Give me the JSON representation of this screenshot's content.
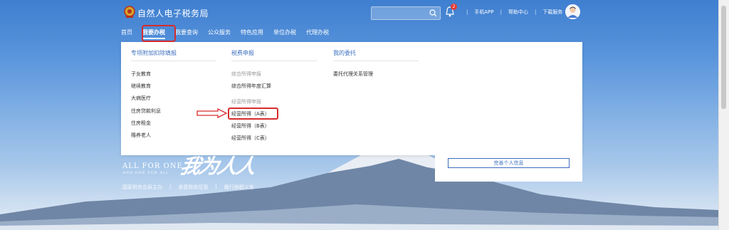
{
  "header": {
    "site_title": "自然人电子税务局",
    "search_placeholder": "",
    "notification_count": "2",
    "links": [
      "手机APP",
      "帮助中心",
      "下载服务"
    ]
  },
  "nav": {
    "items": [
      "首页",
      "我要办税",
      "我要查询",
      "公众服务",
      "特色应用",
      "单位办税",
      "代理办税"
    ],
    "active_index": 1
  },
  "dropdown": {
    "columns": [
      {
        "heading": "专项附加扣除填报",
        "items": [
          "子女教育",
          "继续教育",
          "大病医疗",
          "住房贷款利息",
          "住房租金",
          "赡养老人"
        ]
      },
      {
        "heading": "税费申报",
        "items": [
          {
            "label": "综合所得申报",
            "muted": true
          },
          {
            "label": "综合所得年度汇算",
            "muted": false
          },
          {
            "label": "经营所得申报",
            "muted": true
          },
          {
            "label": "经营所得（A表）",
            "muted": false,
            "highlighted": true
          },
          {
            "label": "经营所得（B表）",
            "muted": false
          },
          {
            "label": "经营所得（C表）",
            "muted": false
          }
        ]
      },
      {
        "heading": "我的委托",
        "items": [
          "委托代理关系管理"
        ]
      }
    ]
  },
  "hero": {
    "slogan_en_line1": "ALL FOR ONE",
    "slogan_en_line2": "AND ONE FOR ALL",
    "slogan_cn": "我为人人",
    "tagline": [
      "国家税务总局主办",
      "承建税收征管",
      "履行纳税义务"
    ],
    "side_button": "完善个人信息"
  },
  "colors": {
    "accent": "#3d6fbf",
    "highlight_red": "#d82c2c",
    "sky_top": "#3f7fd0"
  }
}
